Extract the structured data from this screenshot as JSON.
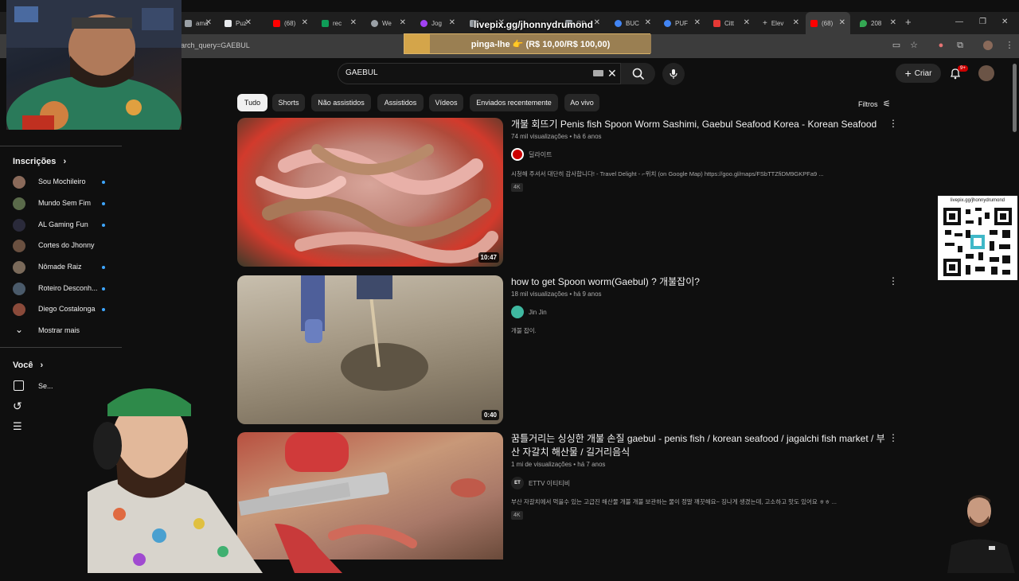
{
  "browser": {
    "tabs": [
      {
        "label": "ama",
        "icon": "tab-icon",
        "color": "#9aa0a6"
      },
      {
        "label": "Puz",
        "icon": "doc-icon",
        "color": "#e8eaed"
      },
      {
        "label": "(68)",
        "icon": "youtube-icon",
        "color": "#ff0000"
      },
      {
        "label": "rec",
        "icon": "sheet-icon",
        "color": "#0f9d58"
      },
      {
        "label": "We",
        "icon": "globe-icon",
        "color": "#9aa0a6"
      },
      {
        "label": "Jog",
        "icon": "color-icon",
        "color": "#a142f4"
      },
      {
        "label": "",
        "icon": "tab-icon",
        "color": "#9aa0a6"
      },
      {
        "label": "OD",
        "icon": "tab-icon",
        "color": "#9aa0a6"
      },
      {
        "label": "BUC",
        "icon": "google-icon",
        "color": "#4285f4"
      },
      {
        "label": "PUF",
        "icon": "google-icon",
        "color": "#4285f4"
      },
      {
        "label": "Citt",
        "icon": "tab-icon",
        "color": "#e53935"
      },
      {
        "label": "Elev",
        "icon": "plus-icon",
        "color": "#e8eaed"
      },
      {
        "label": "(68)",
        "icon": "youtube-icon",
        "color": "#ff0000"
      },
      {
        "label": "208",
        "icon": "maps-icon",
        "color": "#34a853"
      }
    ],
    "url": "arch_query=GAEBUL"
  },
  "overlay": {
    "livepix_url": "livepix.gg/jhonnydrumond",
    "banner_text": "pinga-lhe 👉 (R$ 10,00/R$ 100,00)",
    "qr_label": "livepix.gg/jhonnydrumond"
  },
  "masthead": {
    "search_value": "GAEBUL",
    "create_label": "Criar",
    "notification_count": "9+"
  },
  "chips": [
    "Tudo",
    "Shorts",
    "Não assistidos",
    "Assistidos",
    "Vídeos",
    "Enviados recentemente",
    "Ao vivo"
  ],
  "filters_label": "Filtros",
  "sidebar": {
    "subs_header": "Inscrições",
    "subs": [
      {
        "name": "Sou Mochileiro",
        "color": "#8a6a5a"
      },
      {
        "name": "Mundo Sem Fim",
        "color": "#5a6a4a"
      },
      {
        "name": "AL Gaming Fun",
        "color": "#2a2a3a"
      },
      {
        "name": "Cortes do Jhonny",
        "color": "#6a5040"
      },
      {
        "name": "Nômade Raiz",
        "color": "#7a6a5a"
      },
      {
        "name": "Roteiro Desconh...",
        "color": "#4a5a6a"
      },
      {
        "name": "Diego Costalonga",
        "color": "#8a4a3a"
      }
    ],
    "show_more": "Mostrar mais",
    "you_header": "Você",
    "you_items": [
      "Se...",
      "",
      ""
    ]
  },
  "results": [
    {
      "title": "개불 회뜨기 Penis fish Spoon Worm Sashimi, Gaebul Seafood Korea - Korean Seafood",
      "meta": "74 mil visualizações • há 6 anos",
      "channel": "딜라이트",
      "channel_color": "#cc0000",
      "desc": "시청해 주셔서 대단히 감사합니다! - Travel Delight - ⌐위치 (on Google Map) https://goo.gl/maps/FSbTTZfiDM9GKPFa9 ...",
      "badge": "4K",
      "duration": "10:47"
    },
    {
      "title": "how to get Spoon worm(Gaebul) ? 개불잡이?",
      "meta": "18 mil visualizações • há 9 anos",
      "channel": "Jin Jin",
      "channel_color": "#3fb8a0",
      "desc": "개불 잡이.",
      "badge": "",
      "duration": "0:40"
    },
    {
      "title": "꿈틀거리는 싱싱한 개불 손질 gaebul - penis fish / korean seafood / jagalchi fish market / 부산 자갈치 해산물 / 길거리음식",
      "meta": "1 mi de visualizações • há 7 anos",
      "channel": "ETTV 이티티비",
      "channel_color": "#222222",
      "desc": "부산 자갈치에서 먹을수 있는 고급진 해산물 개불 개불 보관하는 물이 정말 깨끗해요~ 징나게 생겼는데, 고소하고 맛도 있어요 ㅎㅎ ...",
      "badge": "4K",
      "duration": ""
    }
  ]
}
